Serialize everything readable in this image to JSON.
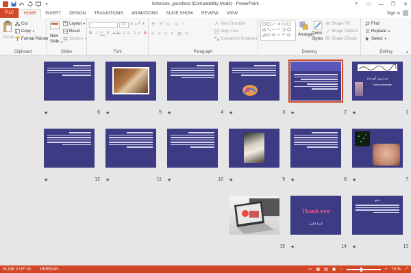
{
  "window": {
    "title": "listenoze_goosfand [Compatibility Mode] - PowerPoint",
    "help": "?",
    "minimize": "—",
    "restore": "❐",
    "close": "✕"
  },
  "tabs": [
    {
      "label": "FILE"
    },
    {
      "label": "HOME"
    },
    {
      "label": "INSERT"
    },
    {
      "label": "DESIGN"
    },
    {
      "label": "TRANSITIONS"
    },
    {
      "label": "ANIMATIONS"
    },
    {
      "label": "SLIDE SHOW"
    },
    {
      "label": "REVIEW"
    },
    {
      "label": "VIEW"
    }
  ],
  "account": {
    "sign_in": "Sign in"
  },
  "ribbon": {
    "clipboard": {
      "label": "Clipboard",
      "paste": "Paste",
      "cut": "Cut",
      "copy": "Copy",
      "format_painter": "Format Painter"
    },
    "slides": {
      "label": "Slides",
      "new_slide": "New",
      "new_slide2": "Slide",
      "layout": "Layout",
      "reset": "Reset",
      "section": "Section"
    },
    "font": {
      "label": "Font",
      "size": "32"
    },
    "paragraph": {
      "label": "Paragraph",
      "text_direction": "Text Direction",
      "align_text": "Align Text",
      "convert": "Convert to SmartArt"
    },
    "drawing": {
      "label": "Drawing",
      "arrange": "Arrange",
      "quick_styles": "Quick",
      "quick_styles2": "Styles",
      "shape_fill": "Shape Fill",
      "shape_outline": "Shape Outline",
      "shape_effects": "Shape Effects"
    },
    "editing": {
      "label": "Editing",
      "find": "Find",
      "replace": "Replace",
      "select": "Select"
    }
  },
  "slides": [
    {
      "number": "1",
      "star": "★",
      "title": "لیستریوز گوسفند",
      "subtitle": "Listeria disease"
    },
    {
      "number": "2",
      "star": "★"
    },
    {
      "number": "3",
      "star": "★"
    },
    {
      "number": "4",
      "star": "★"
    },
    {
      "number": "5",
      "star": "★"
    },
    {
      "number": "6",
      "star": "★"
    },
    {
      "number": "7",
      "star": "★"
    },
    {
      "number": "8",
      "star": "★"
    },
    {
      "number": "9",
      "star": "★"
    },
    {
      "number": "10",
      "star": "★"
    },
    {
      "number": "11",
      "star": "★"
    },
    {
      "number": "12",
      "star": "★"
    },
    {
      "number": "13",
      "star": "★",
      "title": "منابع"
    },
    {
      "number": "14",
      "star": "★",
      "title": "Thank you",
      "subtitle": "کیمیا ناظمی"
    },
    {
      "number": "15",
      "star": ""
    }
  ],
  "status": {
    "slide_info": "SLIDE 2 OF 15",
    "language": "PERSIAN",
    "zoom": "70 %"
  }
}
